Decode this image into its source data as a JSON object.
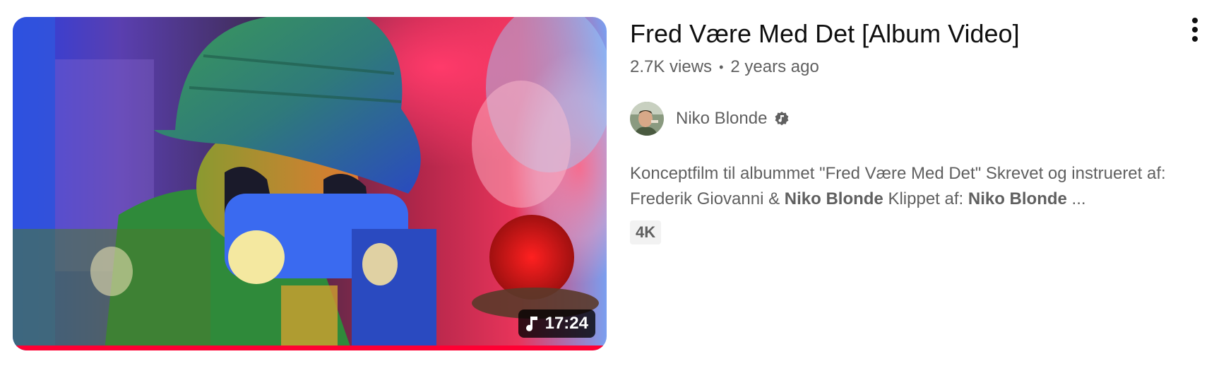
{
  "video": {
    "title": "Fred Være Med Det [Album Video]",
    "views": "2.7K views",
    "separator": "•",
    "age": "2 years ago",
    "duration": "17:24",
    "badge": "4K",
    "watched_progress": 1.0,
    "progress_color": "#ff0033"
  },
  "channel": {
    "name": "Niko Blonde",
    "verified_icon": "music-note-verified-icon",
    "avatar_icon": "channel-avatar"
  },
  "description": {
    "part1": "Konceptfilm til albummet \"Fred Være Med Det\" Skrevet og instrueret af:",
    "part2": "Frederik Giovanni & ",
    "bold1": "Niko Blonde",
    "part3": " Klippet af: ",
    "bold2": "Niko Blonde",
    "ellipsis": " ..."
  },
  "icons": {
    "menu": "more-vertical-icon",
    "duration": "music-note-icon"
  }
}
